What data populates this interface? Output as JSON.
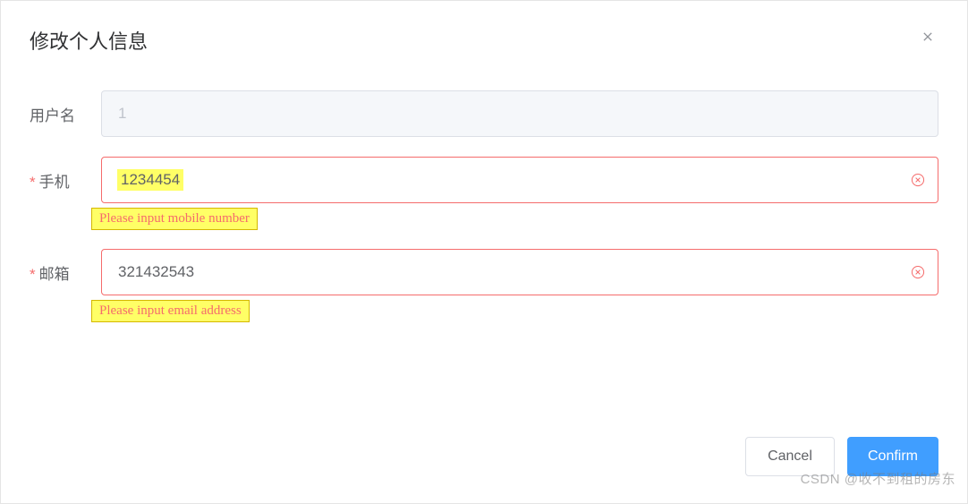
{
  "dialog": {
    "title": "修改个人信息"
  },
  "form": {
    "username": {
      "label": "用户名",
      "value": "1"
    },
    "mobile": {
      "label": "手机",
      "value": "1234454",
      "error": "Please input mobile number"
    },
    "email": {
      "label": "邮箱",
      "value": "321432543",
      "error": "Please input email address"
    }
  },
  "footer": {
    "cancel": "Cancel",
    "confirm": "Confirm"
  },
  "watermark": "CSDN @收不到租的房东"
}
